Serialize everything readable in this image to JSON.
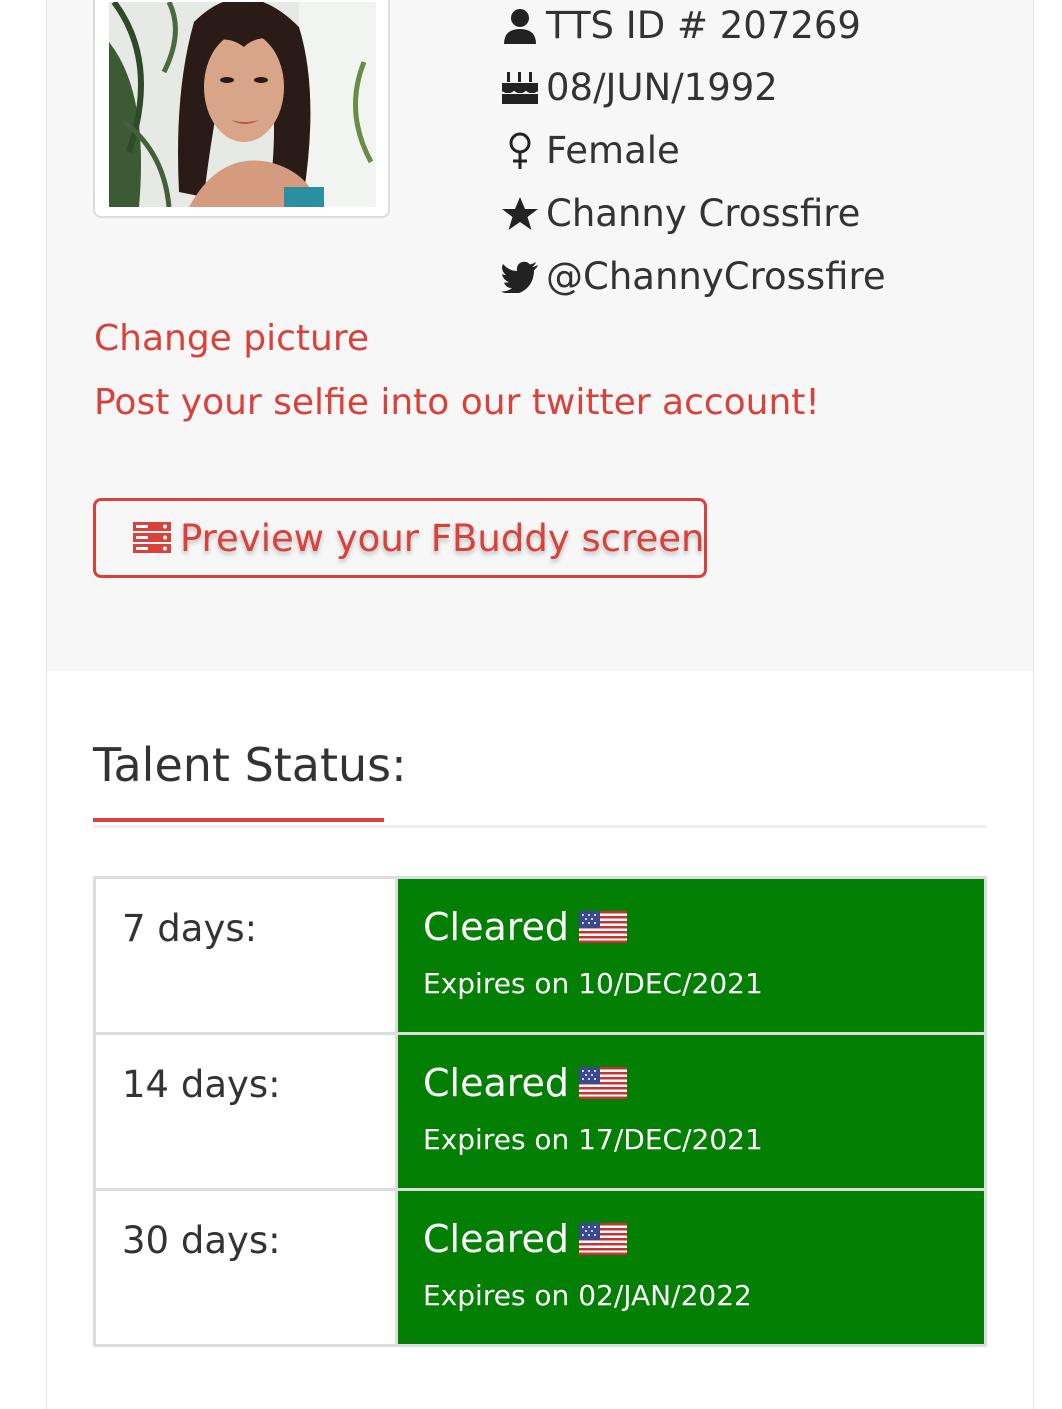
{
  "profile": {
    "tts_id": "TTS ID # 207269",
    "birthdate": "08/JUN/1992",
    "gender": "Female",
    "stage_name": "Channy Crossfire",
    "twitter": "@ChannyCrossfire",
    "icons": {
      "id": "user-icon",
      "birthdate": "birthday-cake-icon",
      "gender": "female-symbol-icon",
      "stage_name": "star-icon",
      "twitter": "twitter-icon"
    }
  },
  "actions": {
    "change_picture": "Change picture",
    "post_selfie": "Post your selfie into our twitter account!",
    "preview_button": "Preview your FBuddy screen",
    "preview_icon": "server-icon"
  },
  "talent_status": {
    "title": "Talent Status:",
    "rows": [
      {
        "period": "7 days:",
        "status": "Cleared",
        "flag": "us-flag-icon",
        "expires": "Expires on 10/DEC/2021"
      },
      {
        "period": "14 days:",
        "status": "Cleared",
        "flag": "us-flag-icon",
        "expires": "Expires on 17/DEC/2021"
      },
      {
        "period": "30 days:",
        "status": "Cleared",
        "flag": "us-flag-icon",
        "expires": "Expires on 02/JAN/2022"
      }
    ]
  },
  "colors": {
    "accent": "#d9413b",
    "cleared_bg": "#038003",
    "text": "#333333",
    "panel_bg": "#f7f7f7"
  }
}
